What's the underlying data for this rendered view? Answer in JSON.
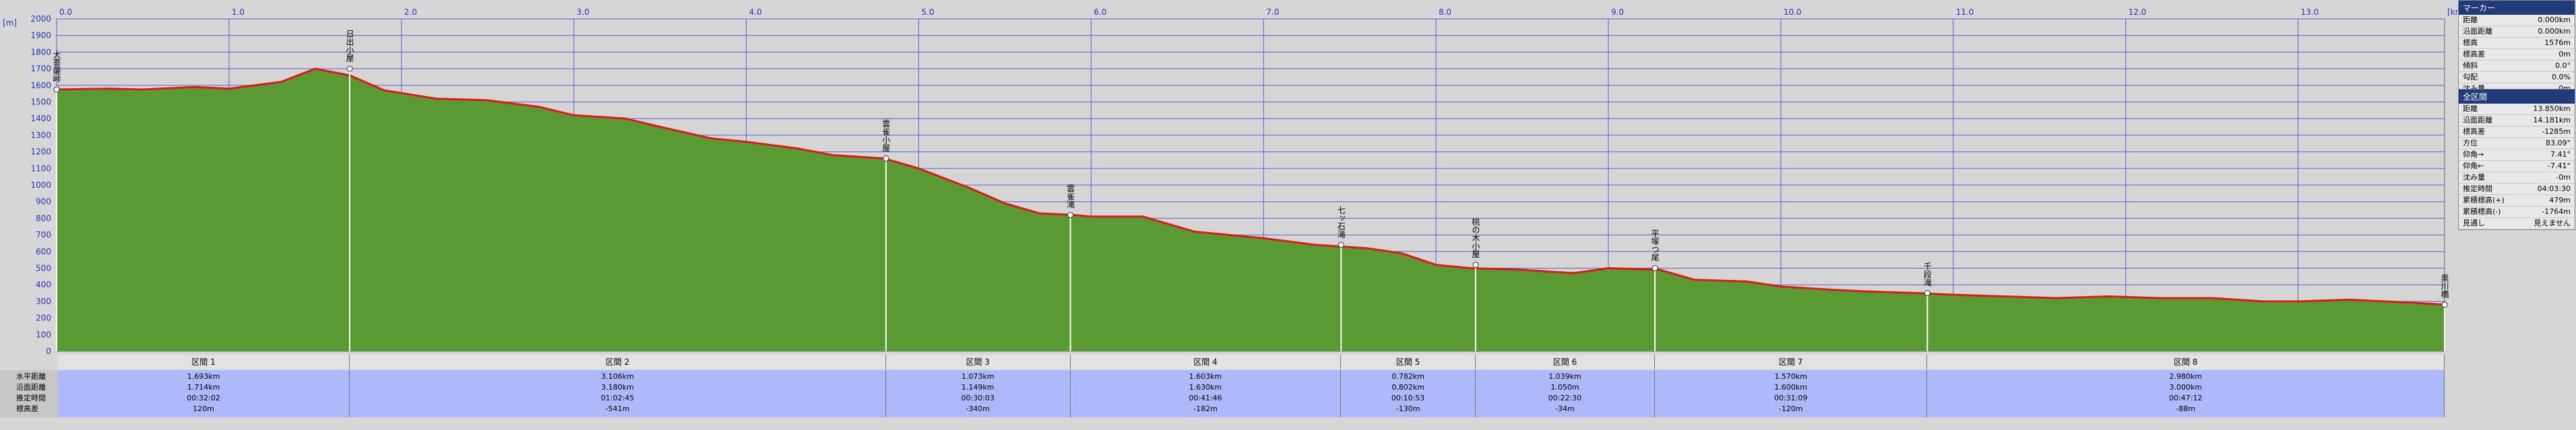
{
  "axis": {
    "y_unit": "[m]",
    "x_unit": "[km]"
  },
  "chart_data": {
    "type": "area",
    "xlim": [
      0,
      13.85
    ],
    "ylim": [
      0,
      2000
    ],
    "x_ticks": [
      "0.0",
      "1.0",
      "2.0",
      "3.0",
      "4.0",
      "5.0",
      "6.0",
      "7.0",
      "8.0",
      "9.0",
      "10.0",
      "11.0",
      "12.0",
      "13.0"
    ],
    "y_ticks": [
      0,
      100,
      200,
      300,
      400,
      500,
      600,
      700,
      800,
      900,
      1000,
      1100,
      1200,
      1300,
      1400,
      1500,
      1600,
      1700,
      1800,
      1900,
      2000
    ],
    "x": [
      0,
      0.3,
      0.5,
      0.8,
      1.0,
      1.3,
      1.5,
      1.7,
      1.9,
      2.2,
      2.5,
      2.8,
      3.0,
      3.3,
      3.5,
      3.8,
      4.0,
      4.3,
      4.5,
      4.8,
      5.0,
      5.3,
      5.5,
      5.7,
      5.9,
      6.0,
      6.3,
      6.6,
      6.8,
      7.0,
      7.3,
      7.6,
      7.8,
      8.0,
      8.2,
      8.5,
      8.8,
      9.0,
      9.3,
      9.5,
      9.8,
      10.0,
      10.3,
      10.5,
      10.8,
      11.0,
      11.3,
      11.6,
      11.9,
      12.2,
      12.5,
      12.8,
      13.0,
      13.3,
      13.5,
      13.7,
      13.85
    ],
    "y": [
      1575,
      1580,
      1575,
      1590,
      1580,
      1620,
      1700,
      1660,
      1570,
      1520,
      1510,
      1470,
      1420,
      1400,
      1350,
      1280,
      1260,
      1220,
      1180,
      1160,
      1100,
      980,
      890,
      830,
      820,
      810,
      810,
      720,
      700,
      680,
      640,
      620,
      590,
      520,
      500,
      490,
      470,
      500,
      490,
      430,
      420,
      390,
      370,
      360,
      350,
      340,
      330,
      320,
      330,
      320,
      320,
      300,
      300,
      310,
      300,
      290,
      280
    ],
    "waypoints": [
      {
        "name": "大菩薩峠",
        "x": 0.0,
        "y": 1575
      },
      {
        "name": "日出小屋",
        "x": 1.7,
        "y": 1700
      },
      {
        "name": "雲雀小屋",
        "x": 4.81,
        "y": 1160
      },
      {
        "name": "雲雀滝",
        "x": 5.88,
        "y": 820
      },
      {
        "name": "七ッ石滝",
        "x": 7.45,
        "y": 640
      },
      {
        "name": "桃の木小屋",
        "x": 8.23,
        "y": 520
      },
      {
        "name": "平塚つ尾",
        "x": 9.27,
        "y": 500
      },
      {
        "name": "千段滝",
        "x": 10.85,
        "y": 350
      },
      {
        "name": "奥川橋",
        "x": 13.85,
        "y": 280
      }
    ]
  },
  "marker_panel": {
    "title": "マーカー",
    "rows": [
      {
        "label": "距離",
        "value": "0.000km"
      },
      {
        "label": "沿面距離",
        "value": "0.000km"
      },
      {
        "label": "標高",
        "value": "1576m"
      },
      {
        "label": "標高差",
        "value": "0m"
      },
      {
        "label": "傾斜",
        "value": "0.0°"
      },
      {
        "label": "勾配",
        "value": "0.0%"
      },
      {
        "label": "沈み量",
        "value": "0m"
      }
    ]
  },
  "section_panel": {
    "title": "全区間",
    "rows": [
      {
        "label": "距離",
        "value": "13.850km"
      },
      {
        "label": "沿面距離",
        "value": "14.181km"
      },
      {
        "label": "標高差",
        "value": "-1285m"
      },
      {
        "label": "方位",
        "value": "83.09°"
      },
      {
        "label": "仰角→",
        "value": "7.41°"
      },
      {
        "label": "仰角←",
        "value": "-7.41°"
      },
      {
        "label": "沈み量",
        "value": "-0m"
      },
      {
        "label": "推定時間",
        "value": "04:03:30"
      },
      {
        "label": "累積標高(+)",
        "value": "479m"
      },
      {
        "label": "累積標高(-)",
        "value": "-1764m"
      },
      {
        "label": "見通し",
        "value": "見えません"
      }
    ]
  },
  "row_labels": [
    "水平距離",
    "沿面距離",
    "推定時間",
    "標高差"
  ],
  "sections": [
    {
      "label": "区間 1",
      "from": 0.0,
      "to": 1.7,
      "h": "1.693km",
      "s": "1.714km",
      "t": "00:32:02",
      "d": "120m"
    },
    {
      "label": "区間 2",
      "from": 1.7,
      "to": 4.81,
      "h": "3.106km",
      "s": "3.180km",
      "t": "01:02:45",
      "d": "-541m"
    },
    {
      "label": "区間 3",
      "from": 4.81,
      "to": 5.88,
      "h": "1.073km",
      "s": "1.149km",
      "t": "00:30:03",
      "d": "-340m"
    },
    {
      "label": "区間 4",
      "from": 5.88,
      "to": 7.45,
      "h": "1.603km",
      "s": "1.630km",
      "t": "00:41:46",
      "d": "-182m"
    },
    {
      "label": "区間 5",
      "from": 7.45,
      "to": 8.23,
      "h": "0.782km",
      "s": "0.802km",
      "t": "00:10:53",
      "d": "-130m"
    },
    {
      "label": "区間 6",
      "from": 8.23,
      "to": 9.27,
      "h": "1.039km",
      "s": "1.050m",
      "t": "00:22:30",
      "d": "-34m"
    },
    {
      "label": "区間 7",
      "from": 9.27,
      "to": 10.85,
      "h": "1.570km",
      "s": "1.600km",
      "t": "00:31:09",
      "d": "-120m"
    },
    {
      "label": "区間 8",
      "from": 10.85,
      "to": 13.85,
      "h": "2.980km",
      "s": "3.000km",
      "t": "00:47:12",
      "d": "-88m"
    }
  ]
}
